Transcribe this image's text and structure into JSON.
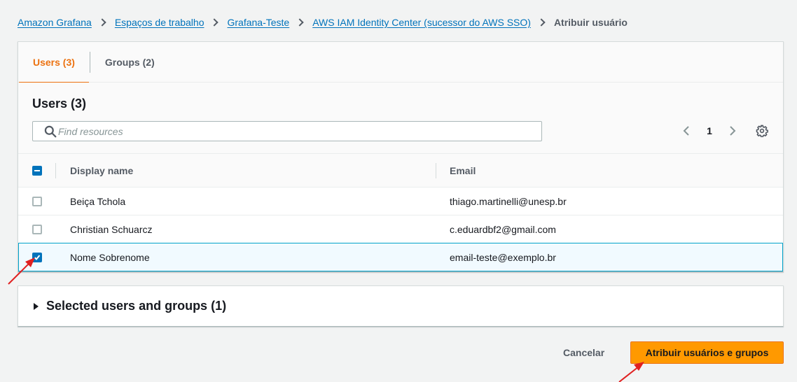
{
  "breadcrumb": {
    "items": [
      "Amazon Grafana",
      "Espaços de trabalho",
      "Grafana-Teste",
      "AWS IAM Identity Center (sucessor do AWS SSO)"
    ],
    "current": "Atribuir usuário"
  },
  "tabs": [
    {
      "label": "Users (3)",
      "active": true
    },
    {
      "label": "Groups (2)",
      "active": false
    }
  ],
  "table": {
    "title": "Users (3)",
    "search_placeholder": "Find resources",
    "page": "1",
    "columns": [
      "Display name",
      "Email"
    ],
    "rows": [
      {
        "name": "Beiça Tchola",
        "email": "thiago.martinelli@unesp.br",
        "checked": false
      },
      {
        "name": "Christian Schuarcz",
        "email": "c.eduardbf2@gmail.com",
        "checked": false
      },
      {
        "name": "Nome Sobrenome",
        "email": "email-teste@exemplo.br",
        "checked": true
      }
    ]
  },
  "selected_section": {
    "label": "Selected users and groups (1)"
  },
  "actions": {
    "cancel": "Cancelar",
    "submit": "Atribuir usuários e grupos"
  },
  "colors": {
    "accent": "#ec7211",
    "primary_button": "#ff9900",
    "link": "#0073bb",
    "annotation_arrow": "#e02020"
  },
  "icons": [
    "search-icon",
    "chevron-left-icon",
    "chevron-right-icon",
    "gear-icon",
    "caret-right-icon",
    "checkmark-icon"
  ]
}
